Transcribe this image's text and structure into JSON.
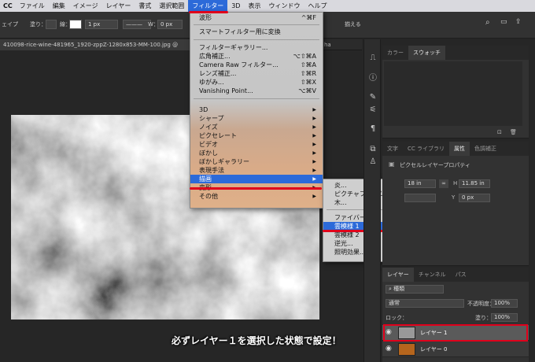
{
  "menubar": {
    "app": "CC",
    "items": [
      "ファイル",
      "編集",
      "イメージ",
      "レイヤー",
      "書式",
      "選択範囲",
      "フィルター",
      "3D",
      "表示",
      "ウィンドウ",
      "ヘルプ"
    ],
    "active": "フィルター"
  },
  "options_bar": {
    "tool_label": "ェイプ",
    "fill_label": "塗り：",
    "stroke_label": "線：",
    "stroke_width": "1 px",
    "w_label": "W：",
    "w_value": "0 px",
    "h_label": "H：",
    "edge_label": "揃える"
  },
  "doc_tab": {
    "title": "410098-rice-wine-481965_1920-zppZ-1280x853-MM-100.jpg @",
    "other": "ha"
  },
  "filter_menu": {
    "group1": [
      {
        "label": "波形",
        "shortcut": "^⌘F"
      }
    ],
    "group2": [
      {
        "label": "スマートフィルター用に変換",
        "shortcut": ""
      }
    ],
    "group3": [
      {
        "label": "フィルターギャラリー...",
        "shortcut": ""
      },
      {
        "label": "広角補正...",
        "shortcut": "⌥⇧⌘A"
      },
      {
        "label": "Camera Raw フィルター...",
        "shortcut": "⇧⌘A"
      },
      {
        "label": "レンズ補正...",
        "shortcut": "⇧⌘R"
      },
      {
        "label": "ゆがみ...",
        "shortcut": "⇧⌘X"
      },
      {
        "label": "Vanishing Point...",
        "shortcut": "⌥⌘V"
      }
    ],
    "group4": [
      {
        "label": "3D"
      },
      {
        "label": "シャープ"
      },
      {
        "label": "ノイズ"
      },
      {
        "label": "ピクセレート"
      },
      {
        "label": "ビデオ"
      },
      {
        "label": "ぼかし"
      },
      {
        "label": "ぼかしギャラリー"
      },
      {
        "label": "表現手法"
      },
      {
        "label": "描画"
      },
      {
        "label": "変形"
      },
      {
        "label": "その他"
      }
    ],
    "selected": "描画"
  },
  "render_submenu": {
    "group1": [
      "炎...",
      "ピクチャフレーム...",
      "木..."
    ],
    "group2": [
      "ファイバー...",
      "雲模様 1",
      "雲模様 2",
      "逆光...",
      "照明効果..."
    ],
    "selected": "雲模様 1"
  },
  "panels": {
    "color_tabs": [
      "カラー",
      "スウォッチ"
    ],
    "props_tabs": [
      "文字",
      "CC ライブラリ",
      "属性",
      "色調補正"
    ],
    "props_title": "ピクセルレイヤープロパティ",
    "w_label": "W",
    "w_value": "18 in",
    "h_label": "H",
    "h_value": "11.85 in",
    "y_label": "Y",
    "y_value": "0 px",
    "layer_tabs": [
      "レイヤー",
      "チャンネル",
      "パス"
    ],
    "kind_label": "種類",
    "blend_mode": "通常",
    "opacity_label": "不透明度：",
    "opacity_value": "100%",
    "lock_label": "ロック：",
    "fill_label": "塗り：",
    "fill_value": "100%",
    "layers": [
      {
        "name": "レイヤー 1"
      },
      {
        "name": "レイヤー 0"
      }
    ]
  },
  "caption": "必ずレイヤー１を選択した状態で設定！",
  "colors": {
    "highlight": "#2c6ad9",
    "annotation_red": "#e0001b"
  }
}
